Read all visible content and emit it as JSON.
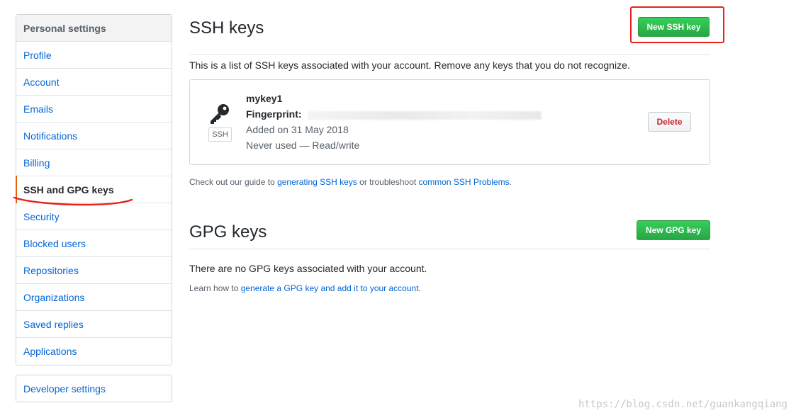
{
  "sidebar": {
    "heading": "Personal settings",
    "items": [
      {
        "label": "Profile"
      },
      {
        "label": "Account"
      },
      {
        "label": "Emails"
      },
      {
        "label": "Notifications"
      },
      {
        "label": "Billing"
      },
      {
        "label": "SSH and GPG keys",
        "selected": true
      },
      {
        "label": "Security"
      },
      {
        "label": "Blocked users"
      },
      {
        "label": "Repositories"
      },
      {
        "label": "Organizations"
      },
      {
        "label": "Saved replies"
      },
      {
        "label": "Applications"
      }
    ],
    "developer_settings": "Developer settings"
  },
  "ssh": {
    "title": "SSH keys",
    "new_button": "New SSH key",
    "description": "This is a list of SSH keys associated with your account. Remove any keys that you do not recognize.",
    "key": {
      "name": "mykey1",
      "fingerprint_label": "Fingerprint:",
      "badge": "SSH",
      "added": "Added on 31 May 2018",
      "usage": "Never used — Read/write",
      "delete_button": "Delete"
    },
    "guide": {
      "prefix": "Check out our guide to ",
      "link1": "generating SSH keys",
      "middle": " or troubleshoot ",
      "link2": "common SSH Problems",
      "suffix": "."
    }
  },
  "gpg": {
    "title": "GPG keys",
    "new_button": "New GPG key",
    "empty": "There are no GPG keys associated with your account.",
    "learn": {
      "prefix": "Learn how to ",
      "link": "generate a GPG key and add it to your account",
      "suffix": "."
    }
  },
  "watermark": "https://blog.csdn.net/guankangqiang",
  "colors": {
    "link": "#0366d6",
    "green": "#28a745",
    "danger": "#cb2431",
    "annotation": "#e8221c"
  }
}
